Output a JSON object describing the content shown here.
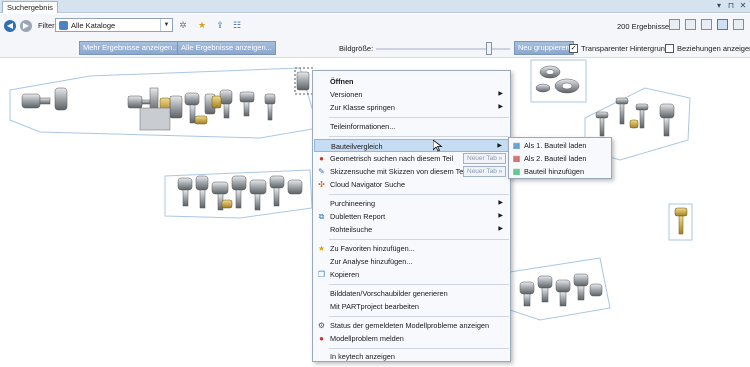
{
  "window": {
    "tab_title": "Suchergebnis",
    "pin_icon": "pin-icon",
    "close_icon": "close-icon"
  },
  "toolbar": {
    "filter_label": "Filter:",
    "filter_value": "Alle Kataloge",
    "result_count": "200 Ergebnisse"
  },
  "subbar": {
    "more_results": "Mehr Ergebnisse anzeigen...",
    "all_results": "Alle Ergebnisse anzeigen...",
    "image_size_label": "Bildgröße:",
    "image_size_percent": 82,
    "regroup": "Neu gruppieren",
    "transparent_bg": "Transparenter Hintergrund",
    "transparent_bg_checked": true,
    "show_relations": "Beziehungen anzeigen",
    "show_relations_checked": false
  },
  "context_menu": {
    "open": "Öffnen",
    "versions": "Versionen",
    "jump_to_class": "Zur Klasse springen",
    "part_info": "Teileinformationen...",
    "part_compare": "Bauteilvergleich",
    "geo_search": "Geometrisch suchen nach diesem Teil",
    "sketch_search": "Skizzensuche mit Skizzen von diesem Teil",
    "new_tab": "Neuer Tab »",
    "cloud_search": "Cloud Navigator Suche",
    "purchineering": "Purchineering",
    "duplicates_report": "Dubletten Report",
    "raw_part_search": "Rohteilsuche",
    "add_favorites": "Zu Favoriten hinzufügen...",
    "add_analysis": "Zur Analyse hinzufügen...",
    "copy": "Kopieren",
    "generate_images": "Bilddaten/Vorschaubilder generieren",
    "edit_partproject": "Mit PARTproject bearbeiten",
    "model_problem_status": "Status der gemeldeten Modellprobleme anzeigen",
    "report_model_problem": "Modellproblem melden",
    "show_keytech": "In keytech anzeigen"
  },
  "submenu": {
    "load_part1": "Als 1. Bauteil laden",
    "load_part2": "Als 2. Bauteil laden",
    "add_part": "Bauteil hinzufügen"
  },
  "colors": {
    "menu_highlight": "#c6dcf3",
    "button_blue": "#8aa7cd",
    "group_outline": "#aac6e6"
  }
}
